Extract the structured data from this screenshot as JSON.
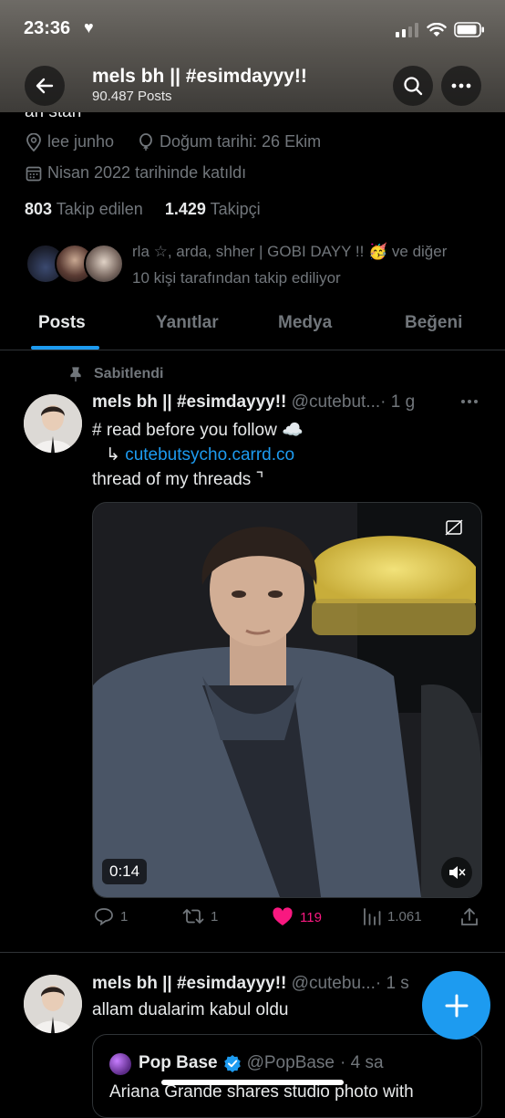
{
  "status_bar": {
    "time": "23:36"
  },
  "header": {
    "profile_name": "mels bh || #esimdayyy!!",
    "post_count": "90.487 Posts",
    "bio_cutoff": "ari stan"
  },
  "profile": {
    "location": "lee junho",
    "birthday": "Doğum tarihi: 26 Ekim",
    "joined": "Nisan 2022 tarihinde katıldı",
    "following_count": "803",
    "following_label": "Takip edilen",
    "followers_count": "1.429",
    "followers_label": "Takipçi",
    "followed_by_line1": "rla ☆, arda, shher | GOBI DAYY !! 🥳 ve diğer",
    "followed_by_line2": "10 kişi tarafından takip ediliyor"
  },
  "tabs": [
    {
      "label": "Posts",
      "active": true
    },
    {
      "label": "Yanıtlar",
      "active": false
    },
    {
      "label": "Medya",
      "active": false
    },
    {
      "label": "Beğeni",
      "active": false
    }
  ],
  "posts": [
    {
      "pinned_label": "Sabitlendi",
      "name": "mels bh || #esimdayyy!!",
      "handle": "@cutebut...",
      "time": "· 1 g",
      "line1": "# read before you follow ☁️",
      "line2_prefix": "↳",
      "line2_link": "cutebutsycho.carrd.co",
      "line3": "thread of my threads ⌝",
      "video_duration": "0:14",
      "replies": "1",
      "reposts": "1",
      "likes": "119",
      "views": "1.061"
    },
    {
      "name": "mels bh || #esimdayyy!!",
      "handle": "@cutebu...",
      "time": "· 1 s",
      "text": "allam dualarim kabul oldu",
      "quote_name": "Pop Base",
      "quote_handle": "@PopBase",
      "quote_time": "· 4 sa",
      "quote_text": "Ariana Grande shares studio photo with"
    }
  ],
  "colors": {
    "accent": "#1d9bf0",
    "like": "#f91880",
    "muted": "#71767b",
    "background": "#000000"
  }
}
